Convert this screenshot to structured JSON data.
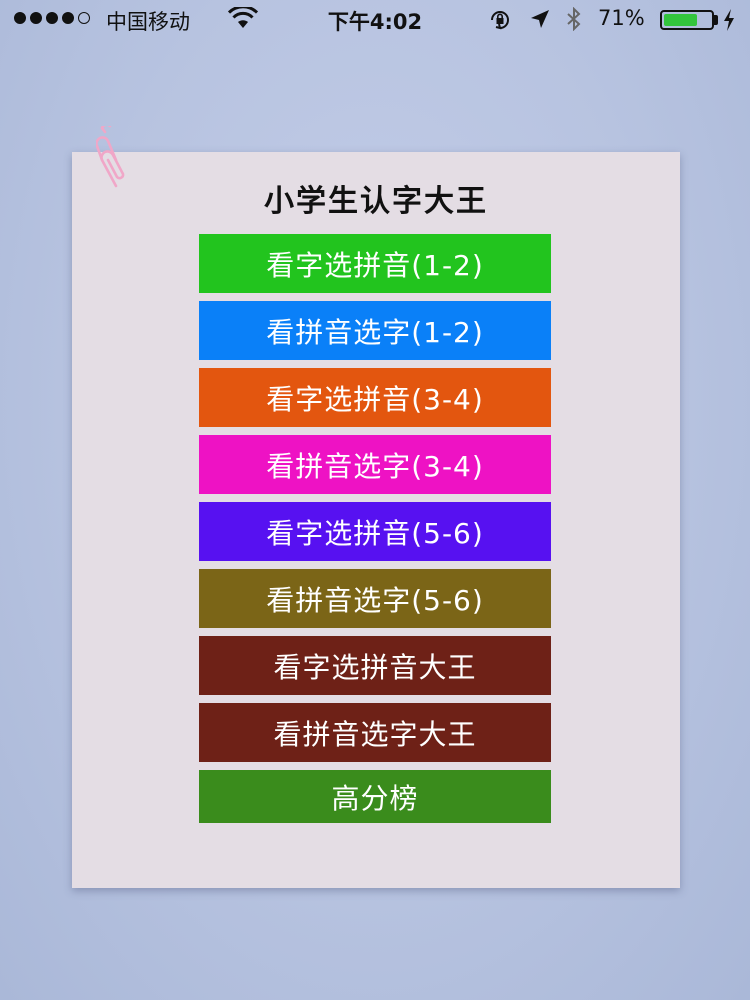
{
  "status_bar": {
    "carrier": "中国移动",
    "time": "下午4:02",
    "battery_percent": "71%",
    "battery_level": 0.71,
    "signal_bars_filled": 4,
    "signal_bars_total": 5,
    "icons": [
      "wifi-icon",
      "orientation-lock-icon",
      "location-icon",
      "bluetooth-icon",
      "battery-icon",
      "charging-icon"
    ]
  },
  "page": {
    "title": "小学生认字大王"
  },
  "menu": {
    "items": [
      {
        "label": "看字选拼音(1-2)",
        "color": "#22c41e"
      },
      {
        "label": "看拼音选字(1-2)",
        "color": "#0a80f8"
      },
      {
        "label": "看字选拼音(3-4)",
        "color": "#e3560f"
      },
      {
        "label": "看拼音选字(3-4)",
        "color": "#ee12c4"
      },
      {
        "label": "看字选拼音(5-6)",
        "color": "#5711f1"
      },
      {
        "label": "看拼音选字(5-6)",
        "color": "#7b6517"
      },
      {
        "label": "看字选拼音大王",
        "color": "#6e2117"
      },
      {
        "label": "看拼音选字大王",
        "color": "#6e2117"
      },
      {
        "label": "高分榜",
        "color": "#3a8c1c"
      }
    ]
  },
  "colors": {
    "background": "#b9c5e2",
    "paper": "#e4dde4",
    "paperclip": "#f0a7c8"
  }
}
